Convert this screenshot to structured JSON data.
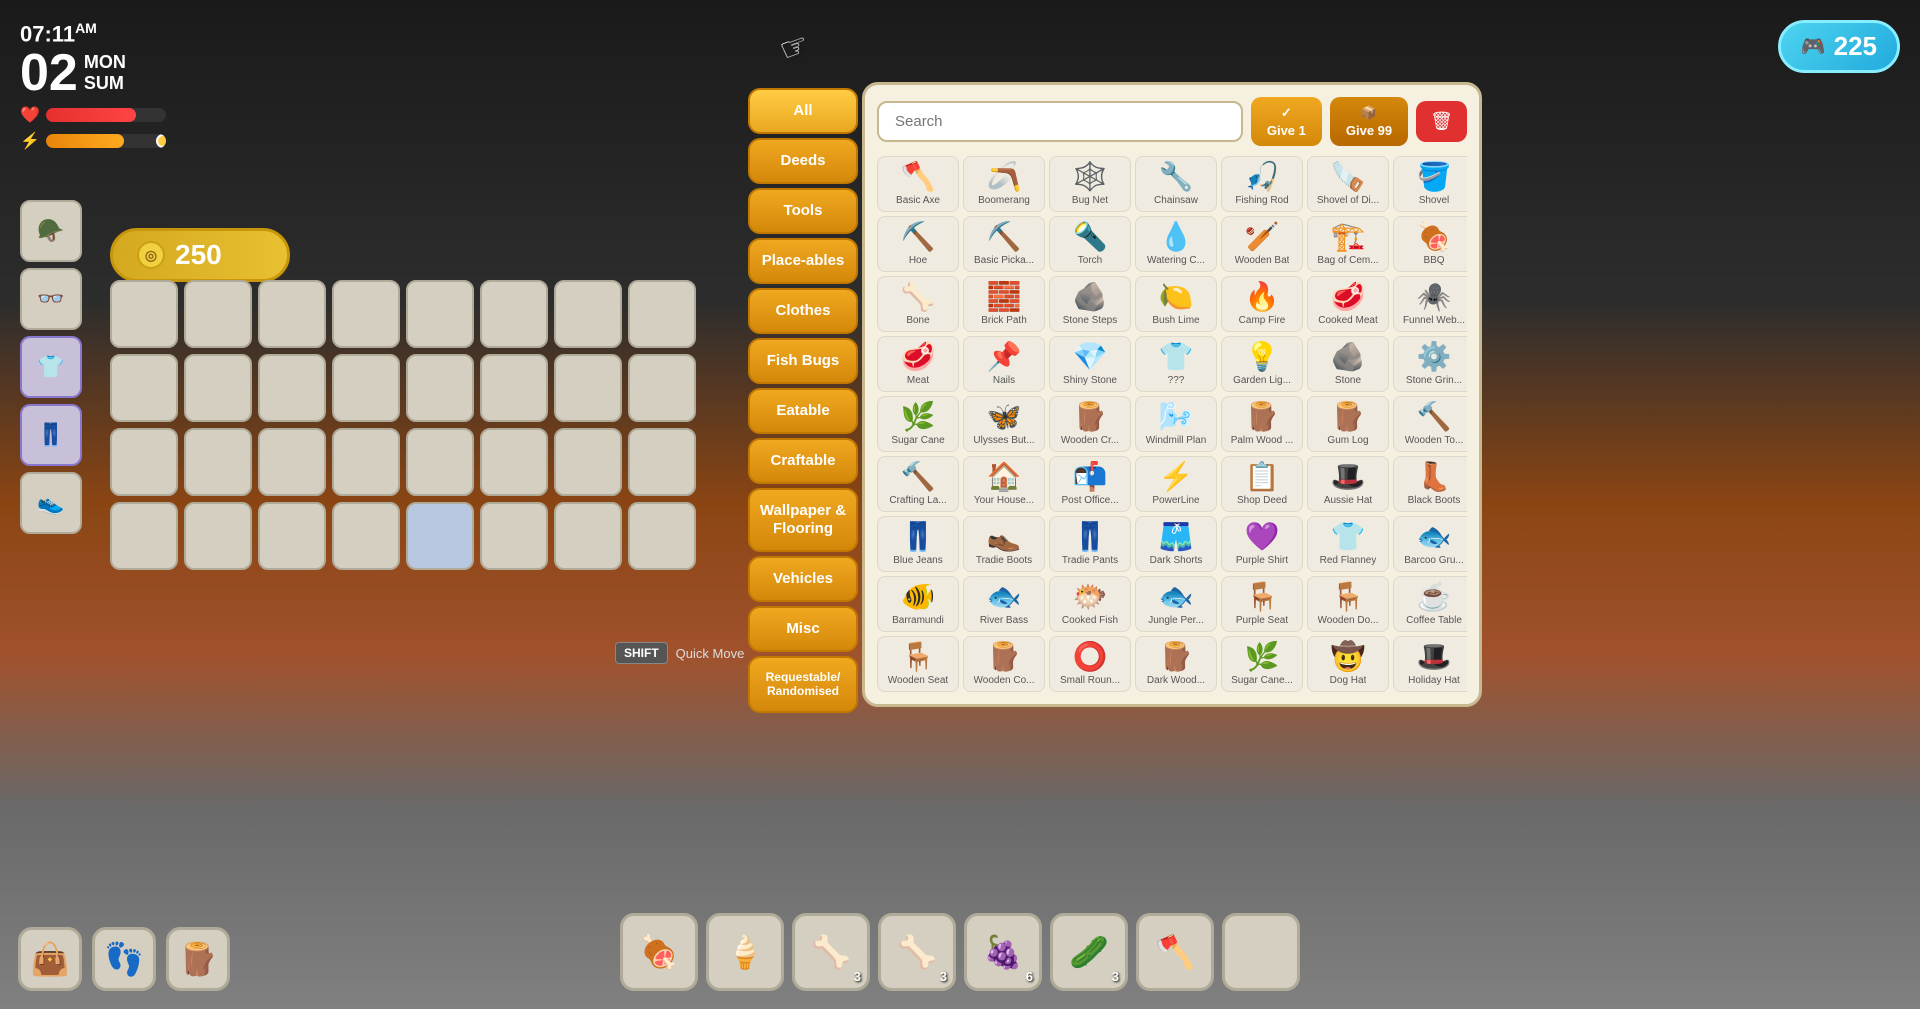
{
  "hud": {
    "time": "07:11",
    "ampm": "AM",
    "date_number": "02",
    "day": "MON",
    "season": "SUM",
    "health_pct": 75,
    "energy_pct": 65
  },
  "currency": {
    "icon": "🎮",
    "amount": "225"
  },
  "gold": {
    "amount": "250"
  },
  "search": {
    "placeholder": "Search"
  },
  "toolbar": {
    "give1_label": "Give 1",
    "give99_label": "Give 99",
    "delete_label": "🗑"
  },
  "categories": [
    {
      "id": "all",
      "label": "All",
      "active": true
    },
    {
      "id": "deeds",
      "label": "Deeds",
      "active": false
    },
    {
      "id": "tools",
      "label": "Tools",
      "active": false
    },
    {
      "id": "placeables",
      "label": "Place-ables",
      "active": false
    },
    {
      "id": "clothes",
      "label": "Clothes",
      "active": false
    },
    {
      "id": "fishbugs",
      "label": "Fish Bugs",
      "active": false
    },
    {
      "id": "eatable",
      "label": "Eatable",
      "active": false
    },
    {
      "id": "craftable",
      "label": "Craftable",
      "active": false
    },
    {
      "id": "wallpaper",
      "label": "Wallpaper & Flooring",
      "active": false
    },
    {
      "id": "vehicles",
      "label": "Vehicles",
      "active": false
    },
    {
      "id": "misc",
      "label": "Misc",
      "active": false
    },
    {
      "id": "requestable",
      "label": "Requestable/ Randomised",
      "active": false
    }
  ],
  "items": [
    {
      "icon": "🪓",
      "label": "Basic Axe"
    },
    {
      "icon": "🪃",
      "label": "Boomerang"
    },
    {
      "icon": "🕸️",
      "label": "Bug Net"
    },
    {
      "icon": "🔧",
      "label": "Chainsaw"
    },
    {
      "icon": "🎣",
      "label": "Fishing Rod"
    },
    {
      "icon": "🪚",
      "label": "Shovel of Di..."
    },
    {
      "icon": "🪣",
      "label": "Shovel"
    },
    {
      "icon": "⛏️",
      "label": "Hoe"
    },
    {
      "icon": "⛏️",
      "label": "Basic Picka..."
    },
    {
      "icon": "🔦",
      "label": "Torch"
    },
    {
      "icon": "💧",
      "label": "Watering C..."
    },
    {
      "icon": "🏏",
      "label": "Wooden Bat"
    },
    {
      "icon": "🏗️",
      "label": "Bag of Cem..."
    },
    {
      "icon": "🍖",
      "label": "BBQ"
    },
    {
      "icon": "🦴",
      "label": "Bone"
    },
    {
      "icon": "🧱",
      "label": "Brick Path"
    },
    {
      "icon": "🪨",
      "label": "Stone Steps"
    },
    {
      "icon": "🍋",
      "label": "Bush Lime"
    },
    {
      "icon": "🔥",
      "label": "Camp Fire"
    },
    {
      "icon": "🥩",
      "label": "Cooked Meat"
    },
    {
      "icon": "🕷️",
      "label": "Funnel Web..."
    },
    {
      "icon": "🥩",
      "label": "Meat"
    },
    {
      "icon": "📌",
      "label": "Nails"
    },
    {
      "icon": "💎",
      "label": "Shiny Stone"
    },
    {
      "icon": "👕",
      "label": "???"
    },
    {
      "icon": "💡",
      "label": "Garden Lig..."
    },
    {
      "icon": "🪨",
      "label": "Stone"
    },
    {
      "icon": "⚙️",
      "label": "Stone Grin..."
    },
    {
      "icon": "🌿",
      "label": "Sugar Cane"
    },
    {
      "icon": "🦋",
      "label": "Ulysses But..."
    },
    {
      "icon": "🪵",
      "label": "Wooden Cr..."
    },
    {
      "icon": "🌬️",
      "label": "Windmill Plan"
    },
    {
      "icon": "🪵",
      "label": "Palm Wood ..."
    },
    {
      "icon": "🪵",
      "label": "Gum Log"
    },
    {
      "icon": "🔨",
      "label": "Wooden To..."
    },
    {
      "icon": "🔨",
      "label": "Crafting La..."
    },
    {
      "icon": "🏠",
      "label": "Your House..."
    },
    {
      "icon": "📬",
      "label": "Post Office..."
    },
    {
      "icon": "⚡",
      "label": "PowerLine"
    },
    {
      "icon": "📋",
      "label": "Shop Deed"
    },
    {
      "icon": "🎩",
      "label": "Aussie Hat"
    },
    {
      "icon": "👢",
      "label": "Black Boots"
    },
    {
      "icon": "👖",
      "label": "Blue Jeans"
    },
    {
      "icon": "👞",
      "label": "Tradie Boots"
    },
    {
      "icon": "👖",
      "label": "Tradie Pants"
    },
    {
      "icon": "🩳",
      "label": "Dark Shorts"
    },
    {
      "icon": "💜",
      "label": "Purple Shirt"
    },
    {
      "icon": "👕",
      "label": "Red Flanney"
    },
    {
      "icon": "🐟",
      "label": "Barcoo Gru..."
    },
    {
      "icon": "🐠",
      "label": "Barramundi"
    },
    {
      "icon": "🐟",
      "label": "River Bass"
    },
    {
      "icon": "🐡",
      "label": "Cooked Fish"
    },
    {
      "icon": "🐟",
      "label": "Jungle Per..."
    },
    {
      "icon": "🪑",
      "label": "Purple Seat"
    },
    {
      "icon": "🪑",
      "label": "Wooden Do..."
    },
    {
      "icon": "☕",
      "label": "Coffee Table"
    },
    {
      "icon": "🪑",
      "label": "Wooden Seat"
    },
    {
      "icon": "🪵",
      "label": "Wooden Co..."
    },
    {
      "icon": "⭕",
      "label": "Small Roun..."
    },
    {
      "icon": "🪵",
      "label": "Dark Wood..."
    },
    {
      "icon": "🌿",
      "label": "Sugar Cane..."
    },
    {
      "icon": "🤠",
      "label": "Dog Hat"
    },
    {
      "icon": "🎩",
      "label": "Holiday Hat"
    }
  ],
  "hotbar": [
    {
      "icon": "🍖",
      "count": "",
      "active": false
    },
    {
      "icon": "🍦",
      "count": "",
      "active": false
    },
    {
      "icon": "🦴",
      "count": "3",
      "active": false
    },
    {
      "icon": "🦴",
      "count": "3",
      "active": false
    },
    {
      "icon": "🍇",
      "count": "6",
      "active": false
    },
    {
      "icon": "🥒",
      "count": "3",
      "active": false
    },
    {
      "icon": "🪓",
      "count": "",
      "active": false
    },
    {
      "icon": "  ",
      "count": "",
      "active": false
    }
  ],
  "quick_move": {
    "key": "SHIFT",
    "label": "Quick Move"
  },
  "sidebar_icons": [
    {
      "icon": "👜",
      "active": false
    },
    {
      "icon": "👣",
      "active": false
    },
    {
      "icon": "🪵",
      "active": false
    }
  ]
}
